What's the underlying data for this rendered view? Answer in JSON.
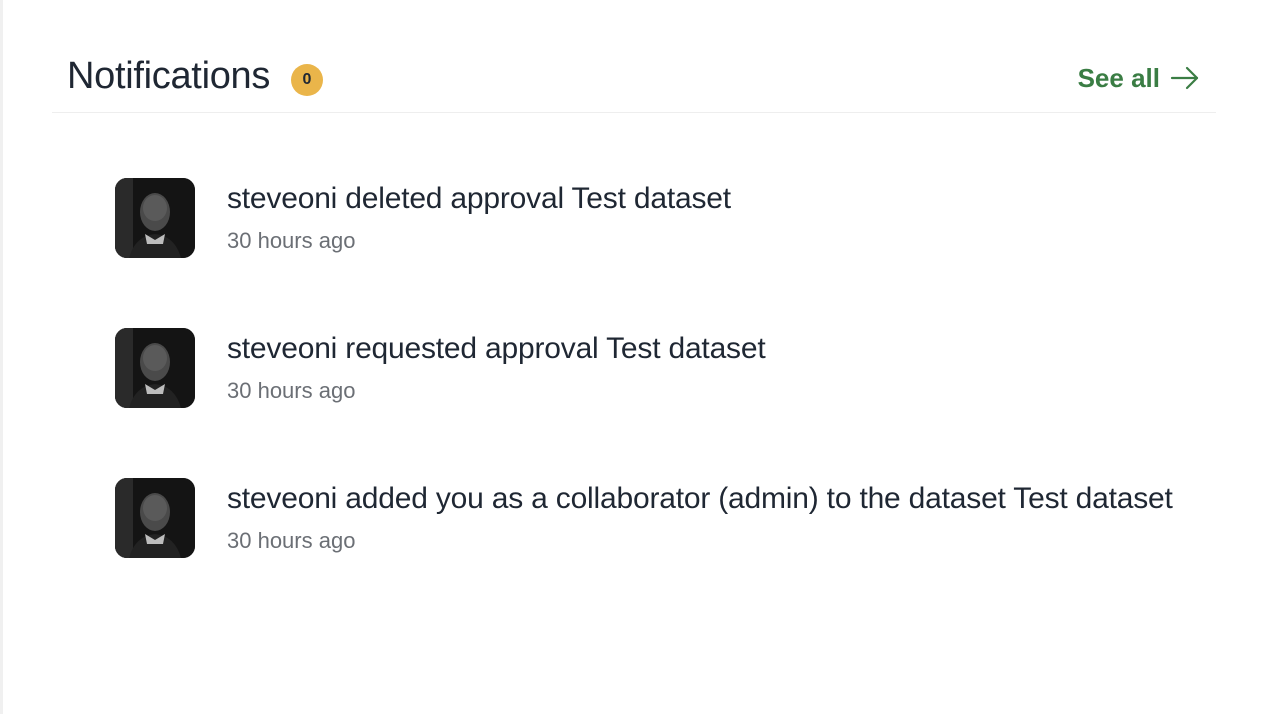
{
  "header": {
    "title": "Notifications",
    "badge_count": "0",
    "see_all_label": "See all",
    "badge_color": "#eab54a",
    "link_color": "#3a7d44"
  },
  "notifications": [
    {
      "message": "steveoni deleted approval Test dataset",
      "time": "30 hours ago",
      "avatar_icon": "user-avatar"
    },
    {
      "message": "steveoni requested approval Test dataset",
      "time": "30 hours ago",
      "avatar_icon": "user-avatar"
    },
    {
      "message": "steveoni added you as a collaborator (admin) to the dataset Test dataset",
      "time": "30 hours ago",
      "avatar_icon": "user-avatar"
    }
  ]
}
